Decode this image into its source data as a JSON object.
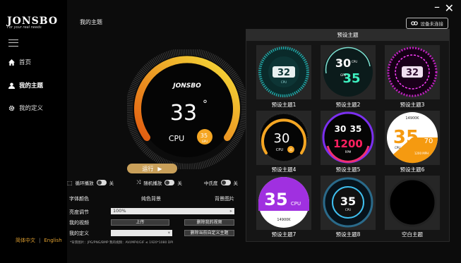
{
  "app": {
    "brand": "JONSBO",
    "tagline": "For your real needs",
    "device_status": "设备未连接"
  },
  "sidebar": {
    "items": [
      {
        "label": "首页"
      },
      {
        "label": "我的主题"
      },
      {
        "label": "我的定义"
      }
    ],
    "lang_zh": "简体中文",
    "lang_en": "English"
  },
  "header": {
    "breadcrumb": "我的主题"
  },
  "preview": {
    "brand": "JONSBO",
    "temp": "33",
    "unit": "°",
    "label": "CPU",
    "badge_temp": "35",
    "badge_unit": "°",
    "badge_label": "GPU"
  },
  "controls": {
    "run_label": "运行",
    "loop_label": "循环播放",
    "loop_state": "关",
    "random_label": "随机播放",
    "random_state": "关",
    "mirror_label": "中氏度",
    "mirror_state": "关",
    "font_color_label": "字体颜色",
    "solid_bg_label": "纯色背景",
    "bg_image_label": "背景图片",
    "brightness_label": "亮度调节",
    "brightness_value": "100%",
    "my_video_label": "我的视频",
    "upload_label": "上传",
    "delete_video_label": "删除我的视频",
    "my_define_label": "我的定义",
    "delete_define_label": "删除当前自定义主题",
    "note": "*背景图片：JPG/PNG/BMP   我的视频：AVI/MP4/GIF ≤ 1920*1080 DPI"
  },
  "themes": {
    "title": "预设主题",
    "items": [
      {
        "label": "预设主题1",
        "value": "32",
        "sub": "CPU"
      },
      {
        "label": "预设主题2",
        "value": "30",
        "value2": "35",
        "sub": "CPU",
        "sub2": "GPU"
      },
      {
        "label": "预设主题3",
        "value": "32"
      },
      {
        "label": "预设主题4",
        "value": "30",
        "sub": "CPU",
        "badge": "35"
      },
      {
        "label": "预设主题5",
        "value": "30",
        "value2": "35",
        "value3": "1200",
        "sub": "RPM"
      },
      {
        "label": "预设主题6",
        "value": "35",
        "value2": "70",
        "top": "14900K",
        "sub": "CPU",
        "sub2": "1200 MPH"
      },
      {
        "label": "预设主题7",
        "value": "35",
        "sub": "CPU",
        "bottom": "14900K"
      },
      {
        "label": "预设主题8",
        "value": "35",
        "sub": "CPU"
      },
      {
        "label": "空白主题"
      }
    ]
  },
  "colors": {
    "accent": "#f5a623",
    "run_button": "#c9a05a",
    "sidebar_bg": "#000000",
    "panel_bg": "#151515"
  }
}
